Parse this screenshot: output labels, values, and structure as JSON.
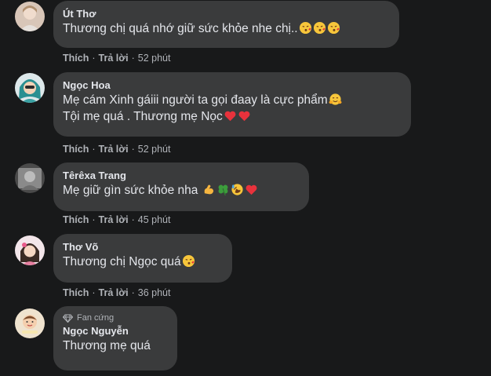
{
  "comments": [
    {
      "author": "Út Thơ",
      "text": "Thương chị quá nhớ giữ sức khỏe nhe chị..",
      "emojis": [
        "kissing-heart-emoji",
        "kissing-heart-emoji",
        "kissing-heart-emoji"
      ],
      "like_label": "Thích",
      "reply_label": "Trả lời",
      "time": "52 phút"
    },
    {
      "author": "Ngọc Hoa",
      "text_line1": "Mẹ cám Xinh gáiii người ta gọi đaay là cực phẩm",
      "text_line2": "Tội mẹ quá . Thương mẹ Nọc",
      "emojis_line1": [
        "hugging-face-emoji"
      ],
      "emojis_line2": [
        "red-heart-emoji",
        "red-heart-emoji"
      ],
      "like_label": "Thích",
      "reply_label": "Trả lời",
      "time": "52 phút"
    },
    {
      "author": "Têrêxa Trang",
      "text": "Mẹ giữ gìn sức khỏe nha",
      "emojis": [
        "flexed-biceps-emoji",
        "four-leaf-clover-emoji",
        "rofl-emoji",
        "red-heart-emoji"
      ],
      "like_label": "Thích",
      "reply_label": "Trả lời",
      "time": "45 phút"
    },
    {
      "author": "Thơ Võ",
      "text": "Thương chị Ngọc quá",
      "emojis": [
        "kissing-heart-emoji"
      ],
      "like_label": "Thích",
      "reply_label": "Trả lời",
      "time": "36 phút"
    },
    {
      "author": "Ngọc Nguyễn",
      "badge": "Fan cứng",
      "badge_icon": "diamond-icon",
      "text": "Thương mẹ quá"
    }
  ],
  "colors": {
    "background": "#18191a",
    "bubble": "#3a3b3c",
    "primary_text": "#e4e6eb",
    "secondary_text": "#b0b3b8"
  }
}
